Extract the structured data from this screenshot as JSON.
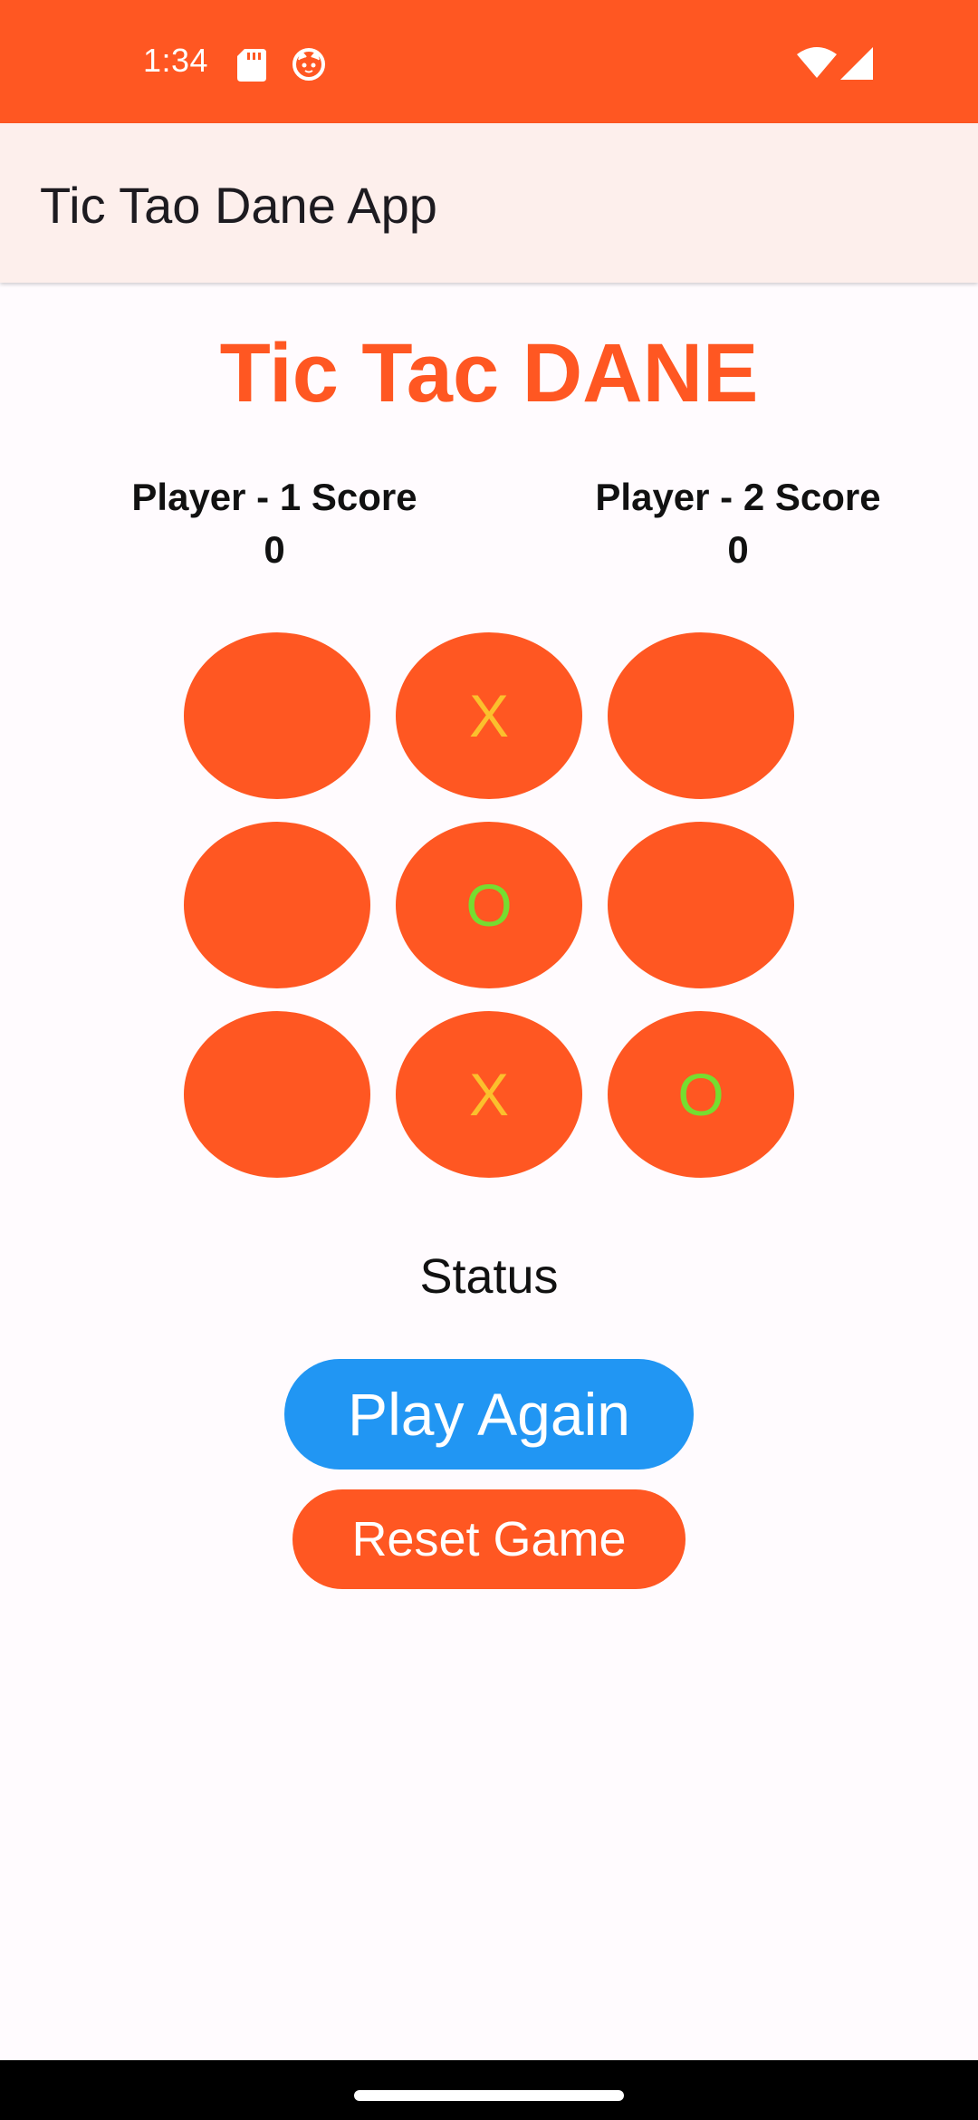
{
  "status_bar": {
    "time": "1:34",
    "icons": [
      "sd-card-icon",
      "cat-notification-icon",
      "wifi-icon",
      "cellular-signal-icon"
    ],
    "background_color": "#FF5722"
  },
  "app_bar": {
    "title": "Tic Tao Dane App",
    "background_color": "#FDEFEC"
  },
  "game": {
    "title": "Tic Tac DANE",
    "title_color": "#FF5722"
  },
  "scores": {
    "player1": {
      "label": "Player - 1 Score",
      "value": "0"
    },
    "player2": {
      "label": "Player - 2 Score",
      "value": "0"
    }
  },
  "board": {
    "cell_color": "#FF5722",
    "x_color": "#FBC02D",
    "o_color": "#76DD30",
    "cells": [
      "",
      "X",
      "",
      "",
      "O",
      "",
      "",
      "X",
      "O"
    ]
  },
  "status": {
    "text": "Status"
  },
  "buttons": {
    "play_again": {
      "label": "Play Again",
      "color": "#2196F3"
    },
    "reset_game": {
      "label": "Reset Game",
      "color": "#FF5722"
    }
  }
}
